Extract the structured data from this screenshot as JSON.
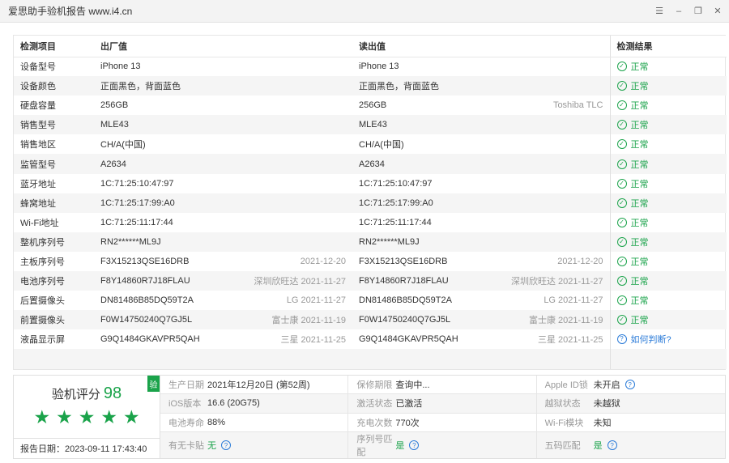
{
  "window": {
    "title": "爱思助手验机报告 www.i4.cn"
  },
  "table": {
    "headers": [
      "检测项目",
      "出厂值",
      "读出值",
      "检测结果"
    ],
    "rows": [
      {
        "item": "设备型号",
        "factory": "iPhone 13",
        "factory_note": "",
        "read": "iPhone 13",
        "read_note": "",
        "result": "正常"
      },
      {
        "item": "设备颜色",
        "factory": "正面黑色，背面蓝色",
        "factory_note": "",
        "read": "正面黑色，背面蓝色",
        "read_note": "",
        "result": "正常"
      },
      {
        "item": "硬盘容量",
        "factory": "256GB",
        "factory_note": "",
        "read": "256GB",
        "read_note": "Toshiba TLC",
        "result": "正常"
      },
      {
        "item": "销售型号",
        "factory": "MLE43",
        "factory_note": "",
        "read": "MLE43",
        "read_note": "",
        "result": "正常"
      },
      {
        "item": "销售地区",
        "factory": "CH/A(中国)",
        "factory_note": "",
        "read": "CH/A(中国)",
        "read_note": "",
        "result": "正常"
      },
      {
        "item": "监管型号",
        "factory": "A2634",
        "factory_note": "",
        "read": "A2634",
        "read_note": "",
        "result": "正常"
      },
      {
        "item": "蓝牙地址",
        "factory": "1C:71:25:10:47:97",
        "factory_note": "",
        "read": "1C:71:25:10:47:97",
        "read_note": "",
        "result": "正常"
      },
      {
        "item": "蜂窝地址",
        "factory": "1C:71:25:17:99:A0",
        "factory_note": "",
        "read": "1C:71:25:17:99:A0",
        "read_note": "",
        "result": "正常"
      },
      {
        "item": "Wi-Fi地址",
        "factory": "1C:71:25:11:17:44",
        "factory_note": "",
        "read": "1C:71:25:11:17:44",
        "read_note": "",
        "result": "正常"
      },
      {
        "item": "整机序列号",
        "factory": "RN2******ML9J",
        "factory_note": "",
        "read": "RN2******ML9J",
        "read_note": "",
        "result": "正常"
      },
      {
        "item": "主板序列号",
        "factory": "F3X15213QSE16DRB",
        "factory_note": "2021-12-20",
        "read": "F3X15213QSE16DRB",
        "read_note": "2021-12-20",
        "result": "正常"
      },
      {
        "item": "电池序列号",
        "factory": "F8Y14860R7J18FLAU",
        "factory_note": "深圳欣旺达 2021-11-27",
        "read": "F8Y14860R7J18FLAU",
        "read_note": "深圳欣旺达 2021-11-27",
        "result": "正常"
      },
      {
        "item": "后置摄像头",
        "factory": "DN81486B85DQ59T2A",
        "factory_note": "LG 2021-11-27",
        "read": "DN81486B85DQ59T2A",
        "read_note": "LG 2021-11-27",
        "result": "正常"
      },
      {
        "item": "前置摄像头",
        "factory": "F0W14750240Q7GJ5L",
        "factory_note": "富士康 2021-11-19",
        "read": "F0W14750240Q7GJ5L",
        "read_note": "富士康 2021-11-19",
        "result": "正常"
      },
      {
        "item": "液晶显示屏",
        "factory": "G9Q1484GKAVPR5QAH",
        "factory_note": "三星 2021-11-25",
        "read": "G9Q1484GKAVPR5QAH",
        "read_note": "三星 2021-11-25",
        "result": "如何判断?",
        "result_type": "help"
      }
    ]
  },
  "score": {
    "label": "验机评分",
    "value": "98",
    "badge": "验",
    "stars": 5,
    "report_date": "报告日期：2023-09-11 17:43:40"
  },
  "info": [
    {
      "key": "生产日期",
      "value": "2021年12月20日 (第52周)",
      "help": false
    },
    {
      "key": "保修期限",
      "value": "查询中...",
      "help": false
    },
    {
      "key": "Apple ID锁",
      "value": "未开启",
      "help": true
    },
    {
      "key": "iOS版本",
      "value": "16.6 (20G75)",
      "help": false
    },
    {
      "key": "激活状态",
      "value": "已激活",
      "help": false
    },
    {
      "key": "越狱状态",
      "value": "未越狱",
      "help": false
    },
    {
      "key": "电池寿命",
      "value": "88%",
      "help": false
    },
    {
      "key": "充电次数",
      "value": "770次",
      "help": false
    },
    {
      "key": "Wi-Fi模块",
      "value": "未知",
      "help": false
    },
    {
      "key": "有无卡贴",
      "value": "无",
      "help": true,
      "green": true
    },
    {
      "key": "序列号匹配",
      "value": "是",
      "help": true,
      "green": true
    },
    {
      "key": "五码匹配",
      "value": "是",
      "help": true,
      "green": true
    }
  ]
}
